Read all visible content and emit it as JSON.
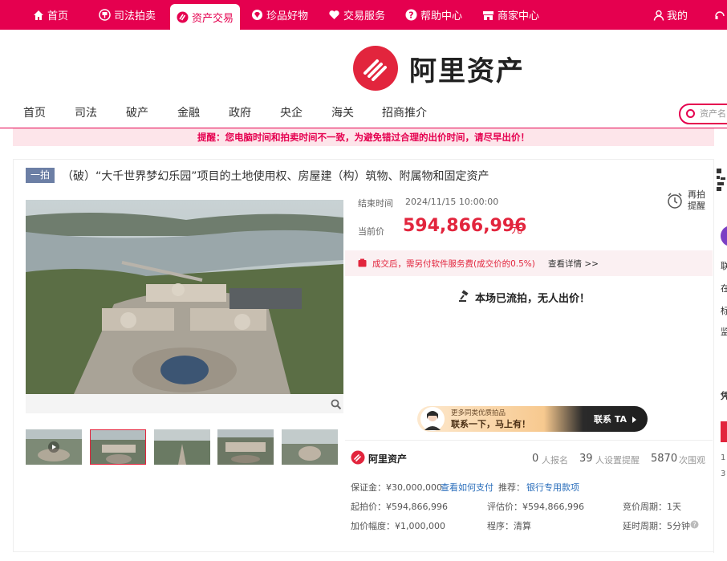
{
  "topnav": [
    {
      "label": "首页",
      "icon": "home-icon"
    },
    {
      "label": "司法拍卖",
      "icon": "gavel-badge-icon"
    },
    {
      "label": "资产交易",
      "icon": "asset-trade-icon"
    },
    {
      "label": "珍品好物",
      "icon": "treasure-icon"
    },
    {
      "label": "交易服务",
      "icon": "heart-icon"
    },
    {
      "label": "帮助中心",
      "icon": "help-icon"
    },
    {
      "label": "商家中心",
      "icon": "merchant-icon"
    }
  ],
  "user_label": "我的",
  "brand": "阿里资产",
  "mainnav": [
    "首页",
    "司法",
    "破产",
    "金融",
    "政府",
    "央企",
    "海关",
    "招商推介"
  ],
  "search_placeholder": "资产名",
  "notice": "提醒：您电脑时间和拍卖时间不一致，为避免错过合理的出价时间，请尽早出价！",
  "item": {
    "tag": "一拍",
    "title": "（破）“大千世界梦幻乐园”项目的土地使用权、房屋建（构）筑物、附属物和固定资产",
    "end_label": "结束时间",
    "end_time": "2024/11/15 10:00:00",
    "price_label": "当前价",
    "price": "594,866,996",
    "price_unit": "元",
    "remind": "再拍\n提醒",
    "fee_text": "成交后，需另付软件服务费(成交价的0.5%)",
    "fee_link": "查看详情 >>",
    "status": "本场已流拍，无人出价！"
  },
  "banner": {
    "line1": "更多同类优质拍品",
    "line2": "联系一下，马上有！",
    "cta": "联系 TA"
  },
  "stats": {
    "brand": "阿里资产",
    "signups": "0",
    "signups_label": "人报名",
    "reminders": "39",
    "reminders_label": "人设置提醒",
    "views": "5870",
    "views_label": "次围观"
  },
  "details": {
    "deposit": "保证金：¥30,000,000",
    "how_pay": "查看如何支付",
    "recommend": "推荐：",
    "bank": "银行专用款项",
    "start_price": "起拍价：¥594,866,996",
    "eval_price": "评估价：¥594,866,996",
    "period": "竞价周期：1天",
    "increment": "加价幅度：¥1,000,000",
    "procedure": "程序：清算",
    "delay": "延时周期：5分钟"
  },
  "right_panel": [
    "联",
    "在",
    "标",
    "监",
    "凭",
    "1",
    "3"
  ],
  "colors": {
    "brand": "#e5004f",
    "price": "#e2253d",
    "tag": "#6c7fa5"
  }
}
